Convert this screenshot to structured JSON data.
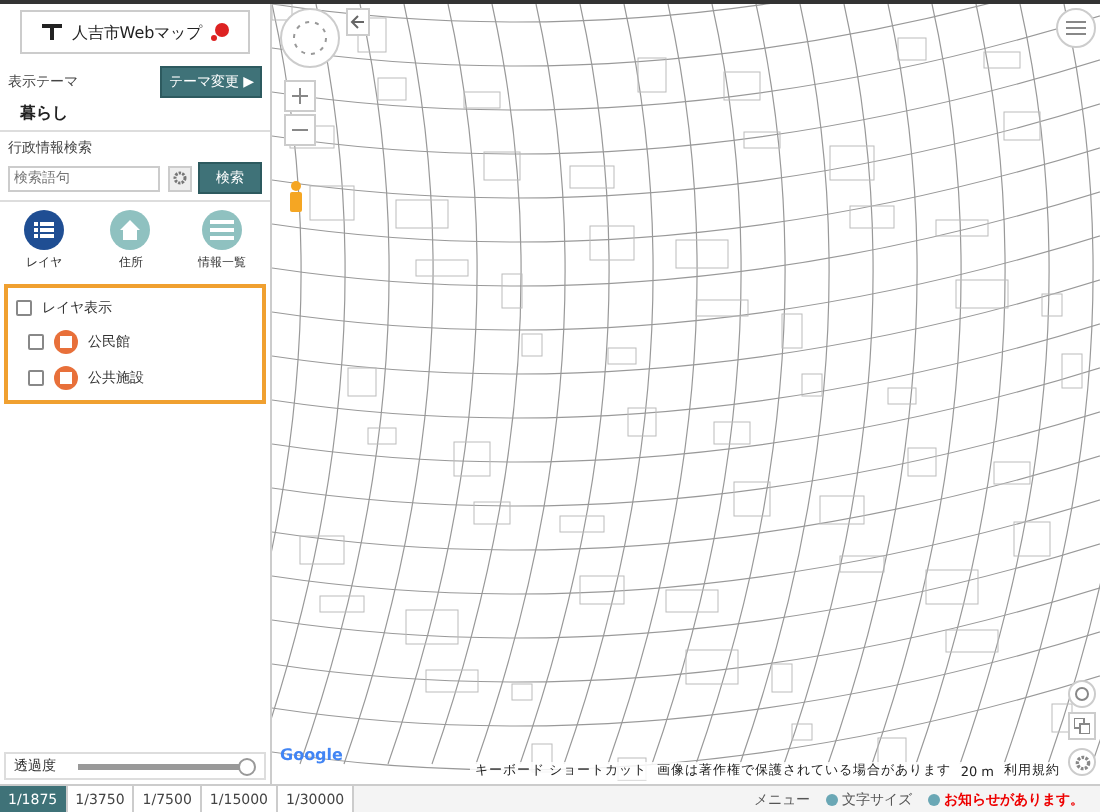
{
  "header": {
    "logo_text": "人吉市Webマップ"
  },
  "theme": {
    "label": "表示テーマ",
    "button": "テーマ変更 ▶",
    "value": "暮らし"
  },
  "search": {
    "label": "行政情報検索",
    "placeholder": "検索語句",
    "button": "検索"
  },
  "modes": [
    {
      "label": "レイヤ",
      "kind": "list",
      "selected": true
    },
    {
      "label": "住所",
      "kind": "home",
      "selected": false
    },
    {
      "label": "情報一覧",
      "kind": "table",
      "selected": false
    }
  ],
  "layers": {
    "title": "レイヤ表示",
    "checked": false,
    "items": [
      {
        "label": "公民館",
        "checked": false
      },
      {
        "label": "公共施設",
        "checked": false
      }
    ]
  },
  "opacity": {
    "label": "透過度",
    "level": 1.0
  },
  "scales": [
    {
      "label": "1/1875",
      "selected": true
    },
    {
      "label": "1/3750",
      "selected": false
    },
    {
      "label": "1/7500",
      "selected": false
    },
    {
      "label": "1/15000",
      "selected": false
    },
    {
      "label": "1/30000",
      "selected": false
    }
  ],
  "map": {
    "logo": "Google",
    "shortcuts": "キーボード ショートカット",
    "copyright": "画像は著作権で保護されている場合があります",
    "scale": "20 m",
    "terms": "利用規約"
  },
  "footer": {
    "menu": "メニュー",
    "font_size": "文字サイズ",
    "notice": "お知らせがあります。"
  }
}
